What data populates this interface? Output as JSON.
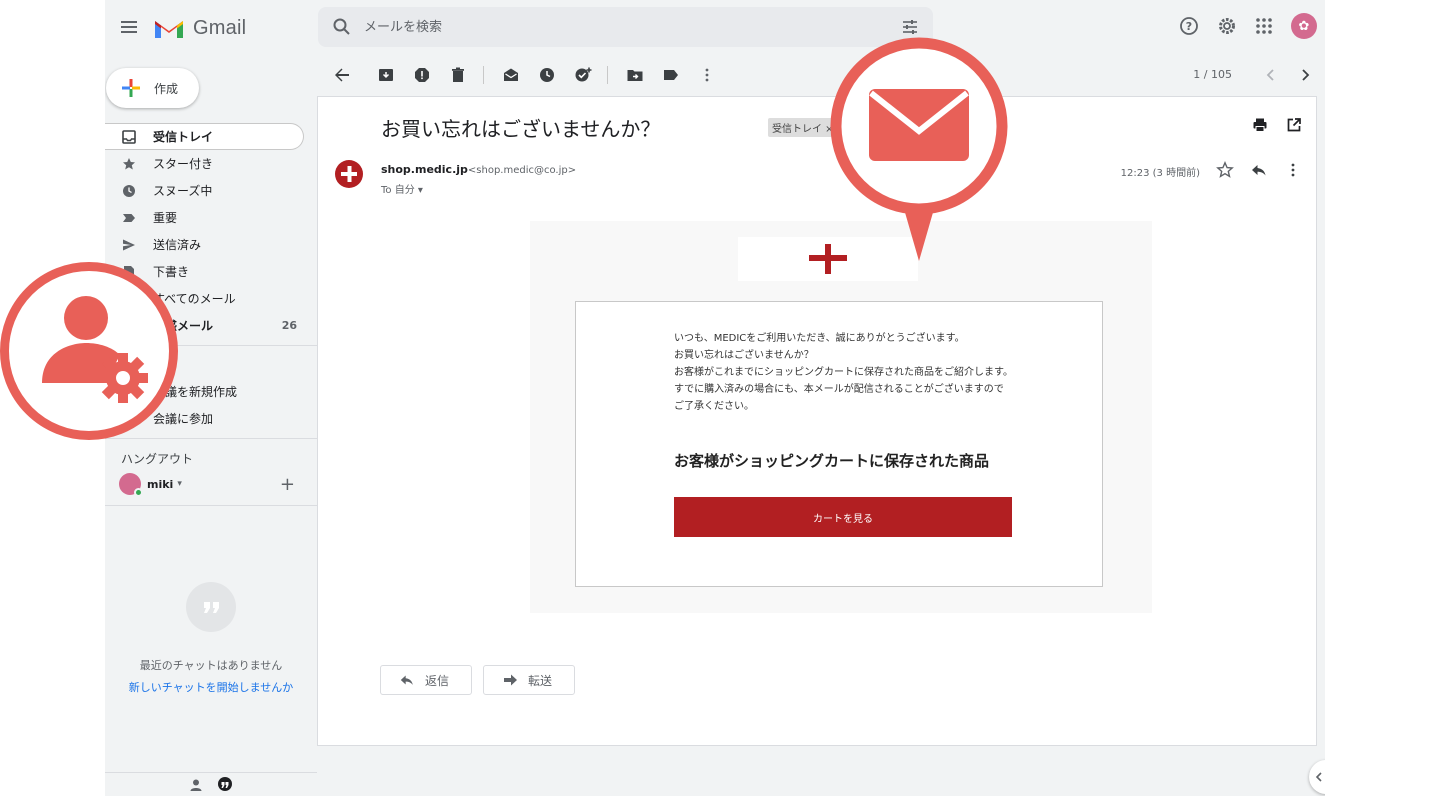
{
  "app": {
    "name": "Gmail"
  },
  "search": {
    "placeholder": "メールを検索"
  },
  "sidebar": {
    "compose_label": "作成",
    "items": [
      {
        "label": "受信トレイ",
        "icon": "inbox-icon",
        "active": true
      },
      {
        "label": "スター付き",
        "icon": "star-icon"
      },
      {
        "label": "スヌーズ中",
        "icon": "clock-icon"
      },
      {
        "label": "重要",
        "icon": "label-important-icon"
      },
      {
        "label": "送信済み",
        "icon": "send-icon"
      },
      {
        "label": "下書き",
        "icon": "draft-icon"
      },
      {
        "label": "すべてのメール",
        "icon": "mail-icon"
      },
      {
        "label": "迷惑メール",
        "icon": "spam-icon",
        "count": "26"
      }
    ],
    "meet_items": [
      {
        "label": "会議を新規作成"
      },
      {
        "label": "会議に参加"
      }
    ],
    "hangouts_label": "ハングアウト",
    "hangouts_user": "miki",
    "chat_empty": "最近のチャットはありません",
    "chat_start": "新しいチャットを開始しませんか"
  },
  "toolbar": {
    "pager": "1 / 105"
  },
  "email": {
    "subject": "お買い忘れはございませんか？",
    "label_chip": "受信トレイ ×",
    "sender_name": "shop.medic.jp",
    "sender_address": "<shop.medic@co.jp>",
    "to_line": "To 自分 ▾",
    "time": "12:23 (3 時間前)",
    "body_text": "いつも、MEDICをご利用いただき、誠にありがとうございます。\nお買い忘れはございませんか？\nお客様がこれまでにショッピングカートに保存された商品をご紹介します。\nすでに購入済みの場合にも、本メールが配信されることがございますので\nご了承ください。",
    "body_heading": "お客様がショッピングカートに保存された商品",
    "cta_label": "カートを見る",
    "reply_label": "返信",
    "forward_label": "転送"
  },
  "colors": {
    "brand_red": "#b21f22",
    "overlay_red": "#e86058",
    "gmail_bg": "#f1f3f4"
  }
}
